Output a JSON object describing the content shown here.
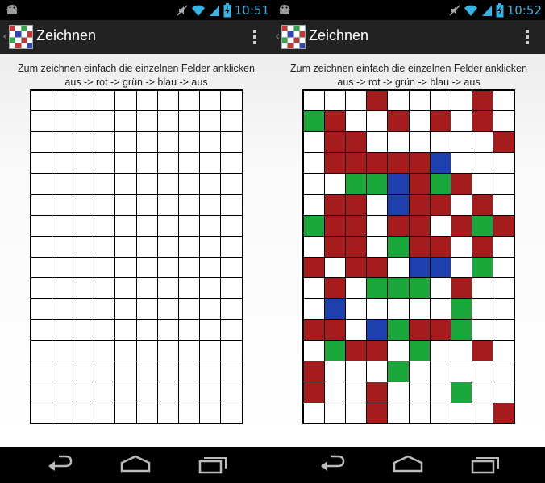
{
  "colors": {
    "off": "#ffffff",
    "red": "#a61b1b",
    "green": "#1ba83a",
    "blue": "#1e3fae",
    "status_accent": "#33b5e5"
  },
  "screens": [
    {
      "status_bar": {
        "time": "10:51",
        "icons": [
          "android-icon",
          "mute-icon",
          "wifi-icon",
          "signal-icon",
          "battery-charging-icon"
        ]
      },
      "action_bar": {
        "title": "Zeichnen",
        "icons": [
          "up-caret-icon",
          "app-icon",
          "overflow-menu-icon"
        ]
      },
      "instructions": {
        "line1": "Zum zeichnen einfach die einzelnen Felder anklicken",
        "line2": "aus -> rot -> grün -> blau -> aus"
      },
      "grid": {
        "columns": 10,
        "rows": 16,
        "cells": [
          "..........",
          "..........",
          "..........",
          "..........",
          "..........",
          "..........",
          "..........",
          "..........",
          "..........",
          "..........",
          "..........",
          "..........",
          "..........",
          "..........",
          "..........",
          ".........."
        ]
      },
      "nav_bar": {
        "icons": [
          "back-icon",
          "home-icon",
          "recent-apps-icon"
        ]
      }
    },
    {
      "status_bar": {
        "time": "10:52",
        "icons": [
          "android-icon",
          "mute-icon",
          "wifi-icon",
          "signal-icon",
          "battery-charging-icon"
        ]
      },
      "action_bar": {
        "title": "Zeichnen",
        "icons": [
          "up-caret-icon",
          "app-icon",
          "overflow-menu-icon"
        ]
      },
      "instructions": {
        "line1": "Zum zeichnen einfach die einzelnen Felder anklicken",
        "line2": "aus -> rot -> grün -> blau -> aus"
      },
      "grid": {
        "columns": 10,
        "rows": 16,
        "cells": [
          "...R....R.",
          "GR..R.R.R.",
          ".RR......R",
          ".RRRRRB...",
          "..GGBRGR..",
          ".RR.BRR.R.",
          "GRR.RR.RGR",
          ".RR.GRR.R.",
          "R.RR.BB.G.",
          ".R.GGG.R..",
          ".B.....G..",
          "RR.BGRRG..",
          ".GRR.G..R.",
          "R...G.....",
          "R..R...G..",
          "...R.....R"
        ]
      },
      "nav_bar": {
        "icons": [
          "back-icon",
          "home-icon",
          "recent-apps-icon"
        ]
      }
    }
  ]
}
